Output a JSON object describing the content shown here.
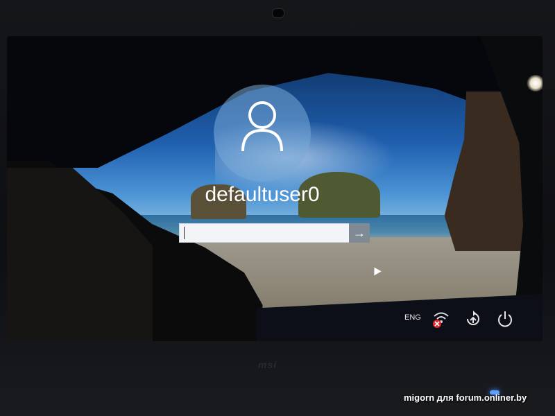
{
  "login": {
    "username": "defaultuser0",
    "password_value": ""
  },
  "tray": {
    "language": "ENG",
    "network_icon": "network-disconnected-icon",
    "ease_icon": "ease-of-access-icon",
    "power_icon": "power-icon"
  },
  "photo": {
    "bezel_brand": "msi",
    "watermark": "migorn для forum.onliner.by"
  },
  "colors": {
    "avatar_circle": "#78aad7",
    "submit_button": "#7f8a95",
    "network_error": "#e0262b",
    "power_led": "#5da0ff"
  }
}
